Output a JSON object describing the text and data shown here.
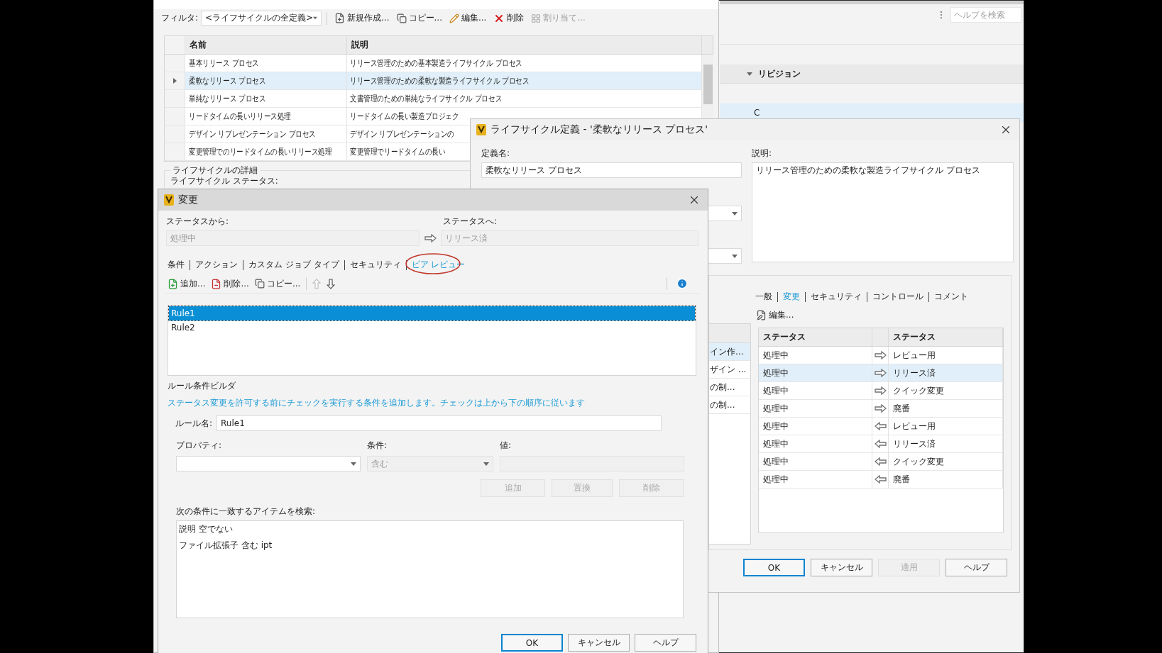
{
  "background_app": {
    "search": {
      "placeholder": "ヘルプを検索"
    },
    "columns": [
      {
        "label": "リビジョン"
      }
    ],
    "rows": [
      {
        "revision": "C",
        "selected": true
      }
    ]
  },
  "lifecycle_window": {
    "filter_label": "フィルタ:",
    "filter_value": "<ライフサイクルの全定義>",
    "toolbar": [
      {
        "kind": "new",
        "label": "新規作成...",
        "disabled": false
      },
      {
        "kind": "copy",
        "label": "コピー...",
        "disabled": false
      },
      {
        "kind": "edit",
        "label": "編集...",
        "disabled": false
      },
      {
        "kind": "delete",
        "label": "削除",
        "disabled": false
      },
      {
        "kind": "assign",
        "label": "割り当て...",
        "disabled": true
      }
    ],
    "columns": [
      "名前",
      "説明"
    ],
    "rows": [
      {
        "name": "基本リリース プロセス",
        "description": "リリース管理のための基本製造ライフサイクル プロセス",
        "selected": false
      },
      {
        "name": "柔軟なリリース プロセス",
        "description": "リリース管理のための柔軟な製造ライフサイクル プロセス",
        "selected": true
      },
      {
        "name": "単純なリリース プロセス",
        "description": "文書管理のための単純なライフサイクル プロセス",
        "selected": false
      },
      {
        "name": "リードタイムの長いリリース処理",
        "description": "リードタイムの長い製造プロジェク",
        "selected": false
      },
      {
        "name": "デザイン リプレゼンテーション プロセス",
        "description": "デザイン リプレゼンテーションの",
        "selected": false
      },
      {
        "name": "変更管理でのリードタイムの長いリリース処理",
        "description": "変更管理でリードタイムの長い",
        "selected": false
      }
    ],
    "details_group": "ライフサイクルの詳細",
    "status_label": "ライフサイクル ステータス:"
  },
  "definition_dialog": {
    "title": "ライフサイクル定義 - '柔軟なリリース プロセス'",
    "name_label": "定義名:",
    "name_value": "柔軟なリリース プロセス",
    "description_label": "説明:",
    "description_value": "リリース管理のための柔軟な製造ライフサイクル プロセス",
    "states_list": [
      {
        "text": "イン作...",
        "selected": true
      },
      {
        "text": "ザイン ...",
        "selected": false
      },
      {
        "text": "の制...",
        "selected": false
      },
      {
        "text": "の制...",
        "selected": false
      }
    ],
    "tabs": [
      {
        "label": "一般",
        "selected": false
      },
      {
        "label": "変更",
        "selected": true
      },
      {
        "label": "セキュリティ",
        "selected": false
      },
      {
        "label": "コントロール",
        "selected": false
      },
      {
        "label": "コメント",
        "selected": false
      }
    ],
    "edit_button": "編集...",
    "transitions": {
      "columns": [
        "ステータス",
        "ステータス"
      ],
      "rows": [
        {
          "from": "処理中",
          "reverse": false,
          "to": "レビュー用",
          "selected": false
        },
        {
          "from": "処理中",
          "reverse": false,
          "to": "リリース済",
          "selected": true
        },
        {
          "from": "処理中",
          "reverse": false,
          "to": "クイック変更",
          "selected": false
        },
        {
          "from": "処理中",
          "reverse": false,
          "to": "廃番",
          "selected": false
        },
        {
          "from": "処理中",
          "reverse": true,
          "to": "レビュー用",
          "selected": false
        },
        {
          "from": "処理中",
          "reverse": true,
          "to": "リリース済",
          "selected": false
        },
        {
          "from": "処理中",
          "reverse": true,
          "to": "クイック変更",
          "selected": false
        },
        {
          "from": "処理中",
          "reverse": true,
          "to": "廃番",
          "selected": false
        }
      ]
    },
    "buttons": [
      {
        "label": "OK",
        "default": true,
        "disabled": false
      },
      {
        "label": "キャンセル",
        "default": false,
        "disabled": false
      },
      {
        "label": "適用",
        "default": false,
        "disabled": true
      },
      {
        "label": "ヘルプ",
        "default": false,
        "disabled": false
      }
    ]
  },
  "change_dialog": {
    "title": "変更",
    "from_label": "ステータスから:",
    "from_value": "処理中",
    "to_label": "ステータスへ:",
    "to_value": "リリース済",
    "tabs": [
      {
        "label": "条件",
        "selected": false,
        "circled": false
      },
      {
        "label": "アクション",
        "selected": false,
        "circled": false
      },
      {
        "label": "カスタム ジョブ タイプ",
        "selected": false,
        "circled": false
      },
      {
        "label": "セキュリティ",
        "selected": false,
        "circled": false
      },
      {
        "label": "ピア レビュー",
        "selected": true,
        "circled": true
      }
    ],
    "toolbar": [
      {
        "kind": "add",
        "label": "追加...",
        "disabled": false
      },
      {
        "kind": "remove",
        "label": "削除...",
        "disabled": false
      },
      {
        "kind": "copy",
        "label": "コピー...",
        "disabled": false
      },
      {
        "kind": "up",
        "disabled": true
      },
      {
        "kind": "down",
        "disabled": false
      }
    ],
    "rules": [
      {
        "name": "Rule1",
        "selected": true
      },
      {
        "name": "Rule2",
        "selected": false
      }
    ],
    "builder_title": "ルール条件ビルダ",
    "builder_hint": "ステータス変更を許可する前にチェックを実行する条件を追加します。チェックは上から下の順序に従います",
    "rule_name_label": "ルール名:",
    "rule_name_value": "Rule1",
    "property_label": "プロパティ:",
    "condition_label": "条件:",
    "condition_value": "含む",
    "value_label": "値:",
    "condition_buttons": [
      {
        "label": "追加",
        "disabled": true
      },
      {
        "label": "置換",
        "disabled": true
      },
      {
        "label": "削除",
        "disabled": true
      }
    ],
    "match_label": "次の条件に一致するアイテムを検索:",
    "criteria": [
      "説明 空でない",
      "ファイル拡張子 含む ipt"
    ],
    "buttons": [
      {
        "label": "OK",
        "default": true,
        "disabled": false
      },
      {
        "label": "キャンセル",
        "default": false,
        "disabled": false
      },
      {
        "label": "ヘルプ",
        "default": false,
        "disabled": false
      }
    ]
  }
}
